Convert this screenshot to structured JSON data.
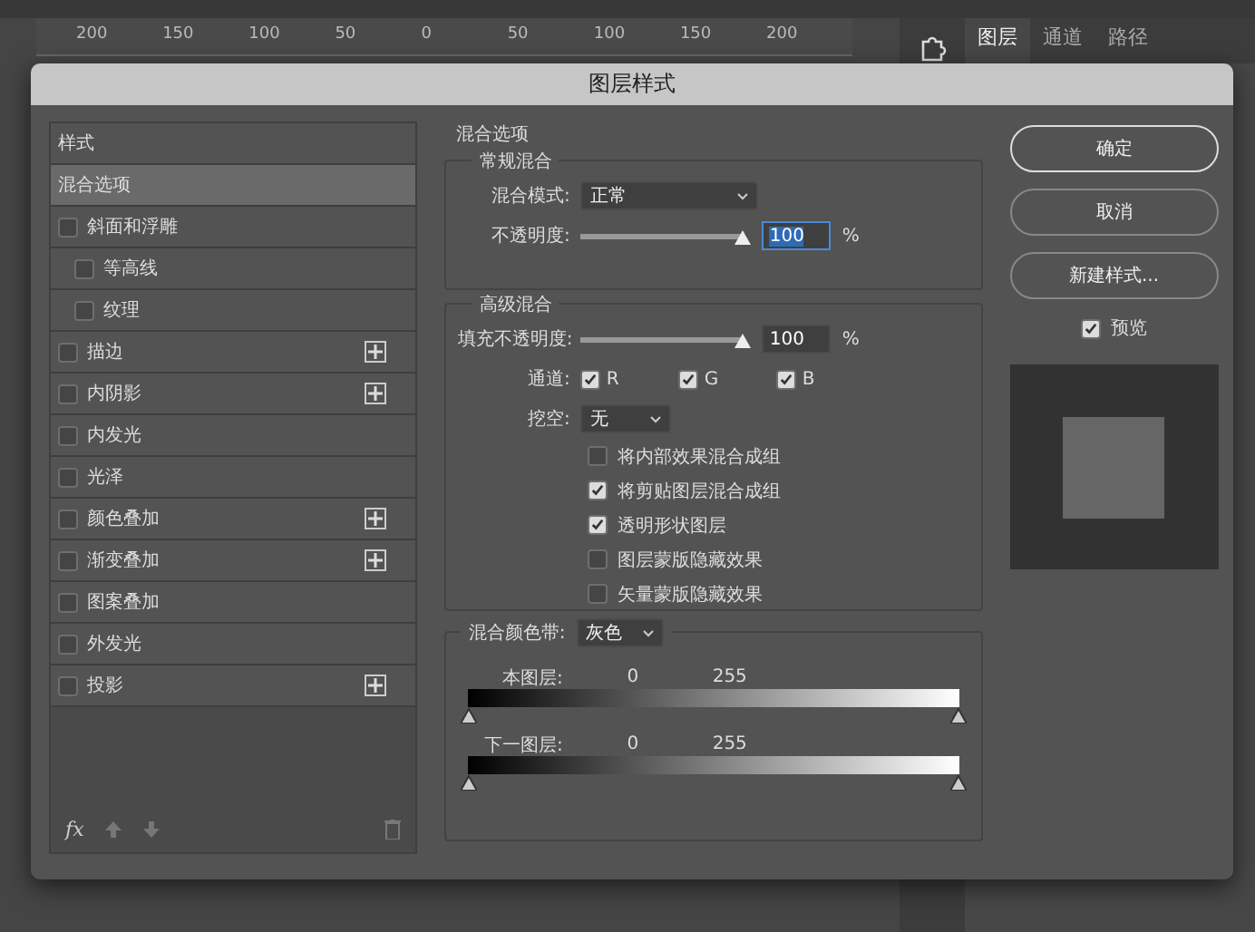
{
  "workspace": {
    "ruler": [
      "200",
      "150",
      "100",
      "50",
      "0",
      "50",
      "100",
      "150",
      "200"
    ],
    "panel_tabs": [
      {
        "label": "图层",
        "selected": true
      },
      {
        "label": "通道",
        "selected": false
      },
      {
        "label": "路径",
        "selected": false
      }
    ]
  },
  "dialog": {
    "title": "图层样式"
  },
  "styles_list": {
    "header": "样式",
    "items": [
      {
        "label": "混合选项",
        "kind": "plain",
        "selected": true
      },
      {
        "label": "斜面和浮雕",
        "kind": "checkbox",
        "selected": false,
        "checked": false,
        "addable": false,
        "children": [
          {
            "label": "等高线",
            "kind": "checkbox",
            "selected": false,
            "checked": false,
            "addable": false
          },
          {
            "label": "纹理",
            "kind": "checkbox",
            "selected": false,
            "checked": false,
            "addable": false
          }
        ]
      },
      {
        "label": "描边",
        "kind": "checkbox",
        "selected": false,
        "checked": false,
        "addable": true
      },
      {
        "label": "内阴影",
        "kind": "checkbox",
        "selected": false,
        "checked": false,
        "addable": true
      },
      {
        "label": "内发光",
        "kind": "checkbox",
        "selected": false,
        "checked": false,
        "addable": false
      },
      {
        "label": "光泽",
        "kind": "checkbox",
        "selected": false,
        "checked": false,
        "addable": false
      },
      {
        "label": "颜色叠加",
        "kind": "checkbox",
        "selected": false,
        "checked": false,
        "addable": true
      },
      {
        "label": "渐变叠加",
        "kind": "checkbox",
        "selected": false,
        "checked": false,
        "addable": true
      },
      {
        "label": "图案叠加",
        "kind": "checkbox",
        "selected": false,
        "checked": false,
        "addable": false
      },
      {
        "label": "外发光",
        "kind": "checkbox",
        "selected": false,
        "checked": false,
        "addable": false
      },
      {
        "label": "投影",
        "kind": "checkbox",
        "selected": false,
        "checked": false,
        "addable": true
      }
    ],
    "footer": {
      "fx": "fx"
    }
  },
  "blending": {
    "title": "混合选项",
    "general": {
      "title": "常规混合",
      "mode": {
        "label": "混合模式:",
        "value": "正常"
      },
      "opacity": {
        "label": "不透明度:",
        "level": 1,
        "value": "100",
        "unit": "%",
        "focused": true
      }
    },
    "advanced": {
      "title": "高级混合",
      "fill": {
        "label": "填充不透明度:",
        "level": 1,
        "value": "100",
        "unit": "%",
        "focused": false
      },
      "channels_label": "通道:",
      "channels": [
        {
          "label": "R",
          "checked": true
        },
        {
          "label": "G",
          "checked": true
        },
        {
          "label": "B",
          "checked": true
        }
      ],
      "knockout": {
        "label": "挖空:",
        "value": "无"
      },
      "options": [
        {
          "label": "将内部效果混合成组",
          "checked": false
        },
        {
          "label": "将剪贴图层混合成组",
          "checked": true
        },
        {
          "label": "透明形状图层",
          "checked": true
        },
        {
          "label": "图层蒙版隐藏效果",
          "checked": false
        },
        {
          "label": "矢量蒙版隐藏效果",
          "checked": false
        }
      ]
    },
    "blend_if": {
      "label": "混合颜色带:",
      "value": "灰色",
      "bands": [
        {
          "label": "本图层:",
          "low": "0",
          "high": "255"
        },
        {
          "label": "下一图层:",
          "low": "0",
          "high": "255"
        }
      ]
    }
  },
  "buttons": [
    {
      "label": "确定",
      "primary": true
    },
    {
      "label": "取消",
      "primary": false
    },
    {
      "label": "新建样式...",
      "primary": false
    }
  ],
  "preview": {
    "label": "预览",
    "checked": true
  }
}
